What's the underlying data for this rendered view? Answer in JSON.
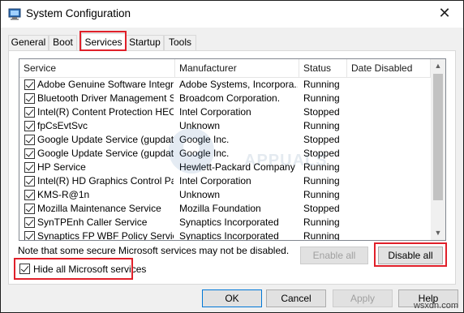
{
  "window": {
    "title": "System Configuration",
    "close_glyph": "✕"
  },
  "tabs": [
    {
      "label": "General"
    },
    {
      "label": "Boot"
    },
    {
      "label": "Services",
      "selected": true
    },
    {
      "label": "Startup"
    },
    {
      "label": "Tools"
    }
  ],
  "services_table": {
    "columns": [
      "Service",
      "Manufacturer",
      "Status",
      "Date Disabled"
    ],
    "rows": [
      {
        "checked": true,
        "service": "Adobe Genuine Software Integri...",
        "manufacturer": "Adobe Systems, Incorpora...",
        "status": "Running"
      },
      {
        "checked": true,
        "service": "Bluetooth Driver Management S...",
        "manufacturer": "Broadcom Corporation.",
        "status": "Running"
      },
      {
        "checked": true,
        "service": "Intel(R) Content Protection HEC...",
        "manufacturer": "Intel Corporation",
        "status": "Stopped"
      },
      {
        "checked": true,
        "service": "fpCsEvtSvc",
        "manufacturer": "Unknown",
        "status": "Running"
      },
      {
        "checked": true,
        "service": "Google Update Service (gupdate)",
        "manufacturer": "Google Inc.",
        "status": "Stopped"
      },
      {
        "checked": true,
        "service": "Google Update Service (gupdatem)",
        "manufacturer": "Google Inc.",
        "status": "Stopped"
      },
      {
        "checked": true,
        "service": "HP Service",
        "manufacturer": "Hewlett-Packard Company",
        "status": "Running"
      },
      {
        "checked": true,
        "service": "Intel(R) HD Graphics Control Pa...",
        "manufacturer": "Intel Corporation",
        "status": "Running"
      },
      {
        "checked": true,
        "service": "KMS-R@1n",
        "manufacturer": "Unknown",
        "status": "Running"
      },
      {
        "checked": true,
        "service": "Mozilla Maintenance Service",
        "manufacturer": "Mozilla Foundation",
        "status": "Stopped"
      },
      {
        "checked": true,
        "service": "SynTPEnh Caller Service",
        "manufacturer": "Synaptics Incorporated",
        "status": "Running"
      },
      {
        "checked": true,
        "service": "Synaptics FP WBF Policy Service",
        "manufacturer": "Synaptics Incorporated",
        "status": "Running"
      }
    ]
  },
  "note": "Note that some secure Microsoft services may not be disabled.",
  "hide_ms": {
    "label": "Hide all Microsoft services",
    "checked": true
  },
  "buttons": {
    "enable_all": "Enable all",
    "disable_all": "Disable all",
    "ok": "OK",
    "cancel": "Cancel",
    "apply": "Apply",
    "help": "Help"
  },
  "watermark": "APPUALS",
  "site_mark": "wsxdn.com",
  "colors": {
    "highlight_box": "#e0202a",
    "default_button_border": "#0078d7"
  },
  "icons": {
    "app": "msconfig-icon",
    "scroll_up": "chevron-up-icon",
    "scroll_down": "chevron-down-icon"
  }
}
